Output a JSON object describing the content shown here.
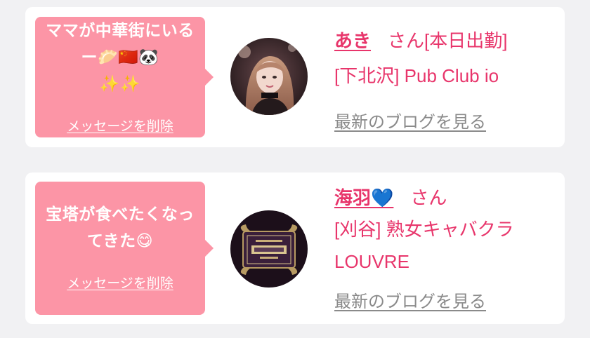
{
  "entries": [
    {
      "message": "ママが中華街にいるー🥟🇨🇳🐼\n✨✨",
      "delete_label": "メッセージを削除",
      "name": "あき",
      "honorific": "さん",
      "status": "[本日出勤]",
      "shop": "[下北沢] Pub Club io",
      "blog_link": "最新のブログを見る"
    },
    {
      "message": "宝塔が食べたくなってきた😋",
      "delete_label": "メッセージを削除",
      "name": "海羽💙",
      "honorific": "さん",
      "status": "",
      "shop": "[刈谷] 熟女キャバクラ LOUVRE",
      "blog_link": "最新のブログを見る"
    }
  ],
  "colors": {
    "page_bg": "#f1f1f3",
    "bubble_bg": "#fc95a6",
    "accent_pink": "#e8356b",
    "link_gray": "#8a8a8a"
  }
}
